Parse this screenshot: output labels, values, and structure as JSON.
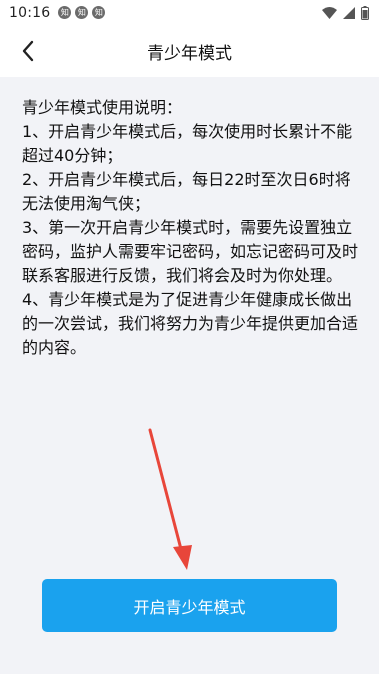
{
  "status_bar": {
    "time": "10:16",
    "notification_badges": [
      "知",
      "知",
      "知"
    ],
    "icons": [
      "wifi-icon",
      "signal-icon",
      "battery-icon"
    ]
  },
  "header": {
    "title": "青少年模式",
    "back_icon": "chevron-left-icon"
  },
  "instructions": {
    "heading": "青少年模式使用说明：",
    "items": [
      "1、开启青少年模式后，每次使用时长累计不能超过40分钟；",
      "2、开启青少年模式后，每日22时至次日6时将无法使用淘气侠；",
      "3、第一次开启青少年模式时，需要先设置独立密码，监护人需要牢记密码，如忘记密码可及时联系客服进行反馈，我们将会及时为你处理。",
      "4、青少年模式是为了促进青少年健康成长做出的一次尝试，我们将努力为青少年提供更加合适的内容。"
    ]
  },
  "primary_button": {
    "label": "开启青少年模式"
  },
  "colors": {
    "accent": "#1aa2ee",
    "background": "#f2f3f7",
    "arrow": "#e8463a"
  }
}
